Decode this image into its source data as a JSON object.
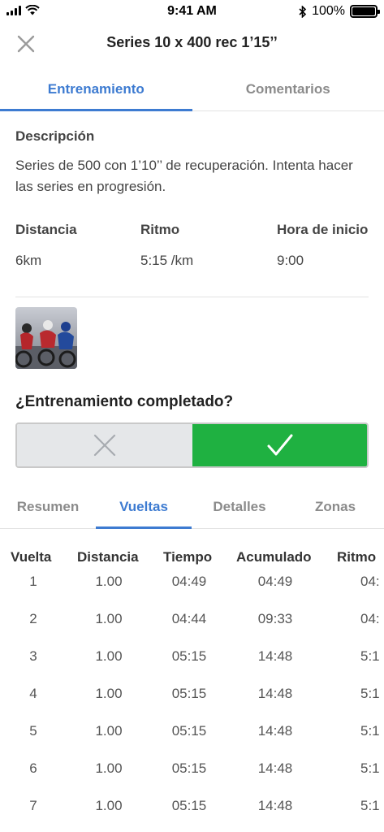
{
  "status_bar": {
    "time": "9:41 AM",
    "battery": "100%"
  },
  "header": {
    "title": "Series 10 x 400 rec 1’15’’"
  },
  "tabs": [
    {
      "label": "Entrenamiento",
      "active": true
    },
    {
      "label": "Comentarios",
      "active": false
    }
  ],
  "description": {
    "title": "Descripción",
    "text": "Series de 500 con 1’10’’ de recuperación. Intenta hacer las series en progresión."
  },
  "metrics": [
    {
      "label": "Distancia",
      "value": "6km"
    },
    {
      "label": "Ritmo",
      "value": "5:15 /km"
    },
    {
      "label": "Hora de inicio",
      "value": "9:00"
    }
  ],
  "completed": {
    "question": "¿Entrenamiento completado?",
    "selected": "yes",
    "accent": "#1fb141"
  },
  "sub_tabs": [
    {
      "label": "Resumen",
      "active": false
    },
    {
      "label": "Vueltas",
      "active": true
    },
    {
      "label": "Detalles",
      "active": false
    },
    {
      "label": "Zonas",
      "active": false
    }
  ],
  "laps": {
    "columns": [
      "Vuelta",
      "Distancia",
      "Tiempo",
      "Acumulado",
      "Ritmo"
    ],
    "rows": [
      [
        "1",
        "1.00",
        "04:49",
        "04:49",
        "04:"
      ],
      [
        "2",
        "1.00",
        "04:44",
        "09:33",
        "04:"
      ],
      [
        "3",
        "1.00",
        "05:15",
        "14:48",
        "5:1"
      ],
      [
        "4",
        "1.00",
        "05:15",
        "14:48",
        "5:1"
      ],
      [
        "5",
        "1.00",
        "05:15",
        "14:48",
        "5:1"
      ],
      [
        "6",
        "1.00",
        "05:15",
        "14:48",
        "5:1"
      ],
      [
        "7",
        "1.00",
        "05:15",
        "14:48",
        "5:1"
      ]
    ]
  },
  "colors": {
    "primary": "#3d7bd1",
    "inactive_tab": "#8b8b8b"
  }
}
